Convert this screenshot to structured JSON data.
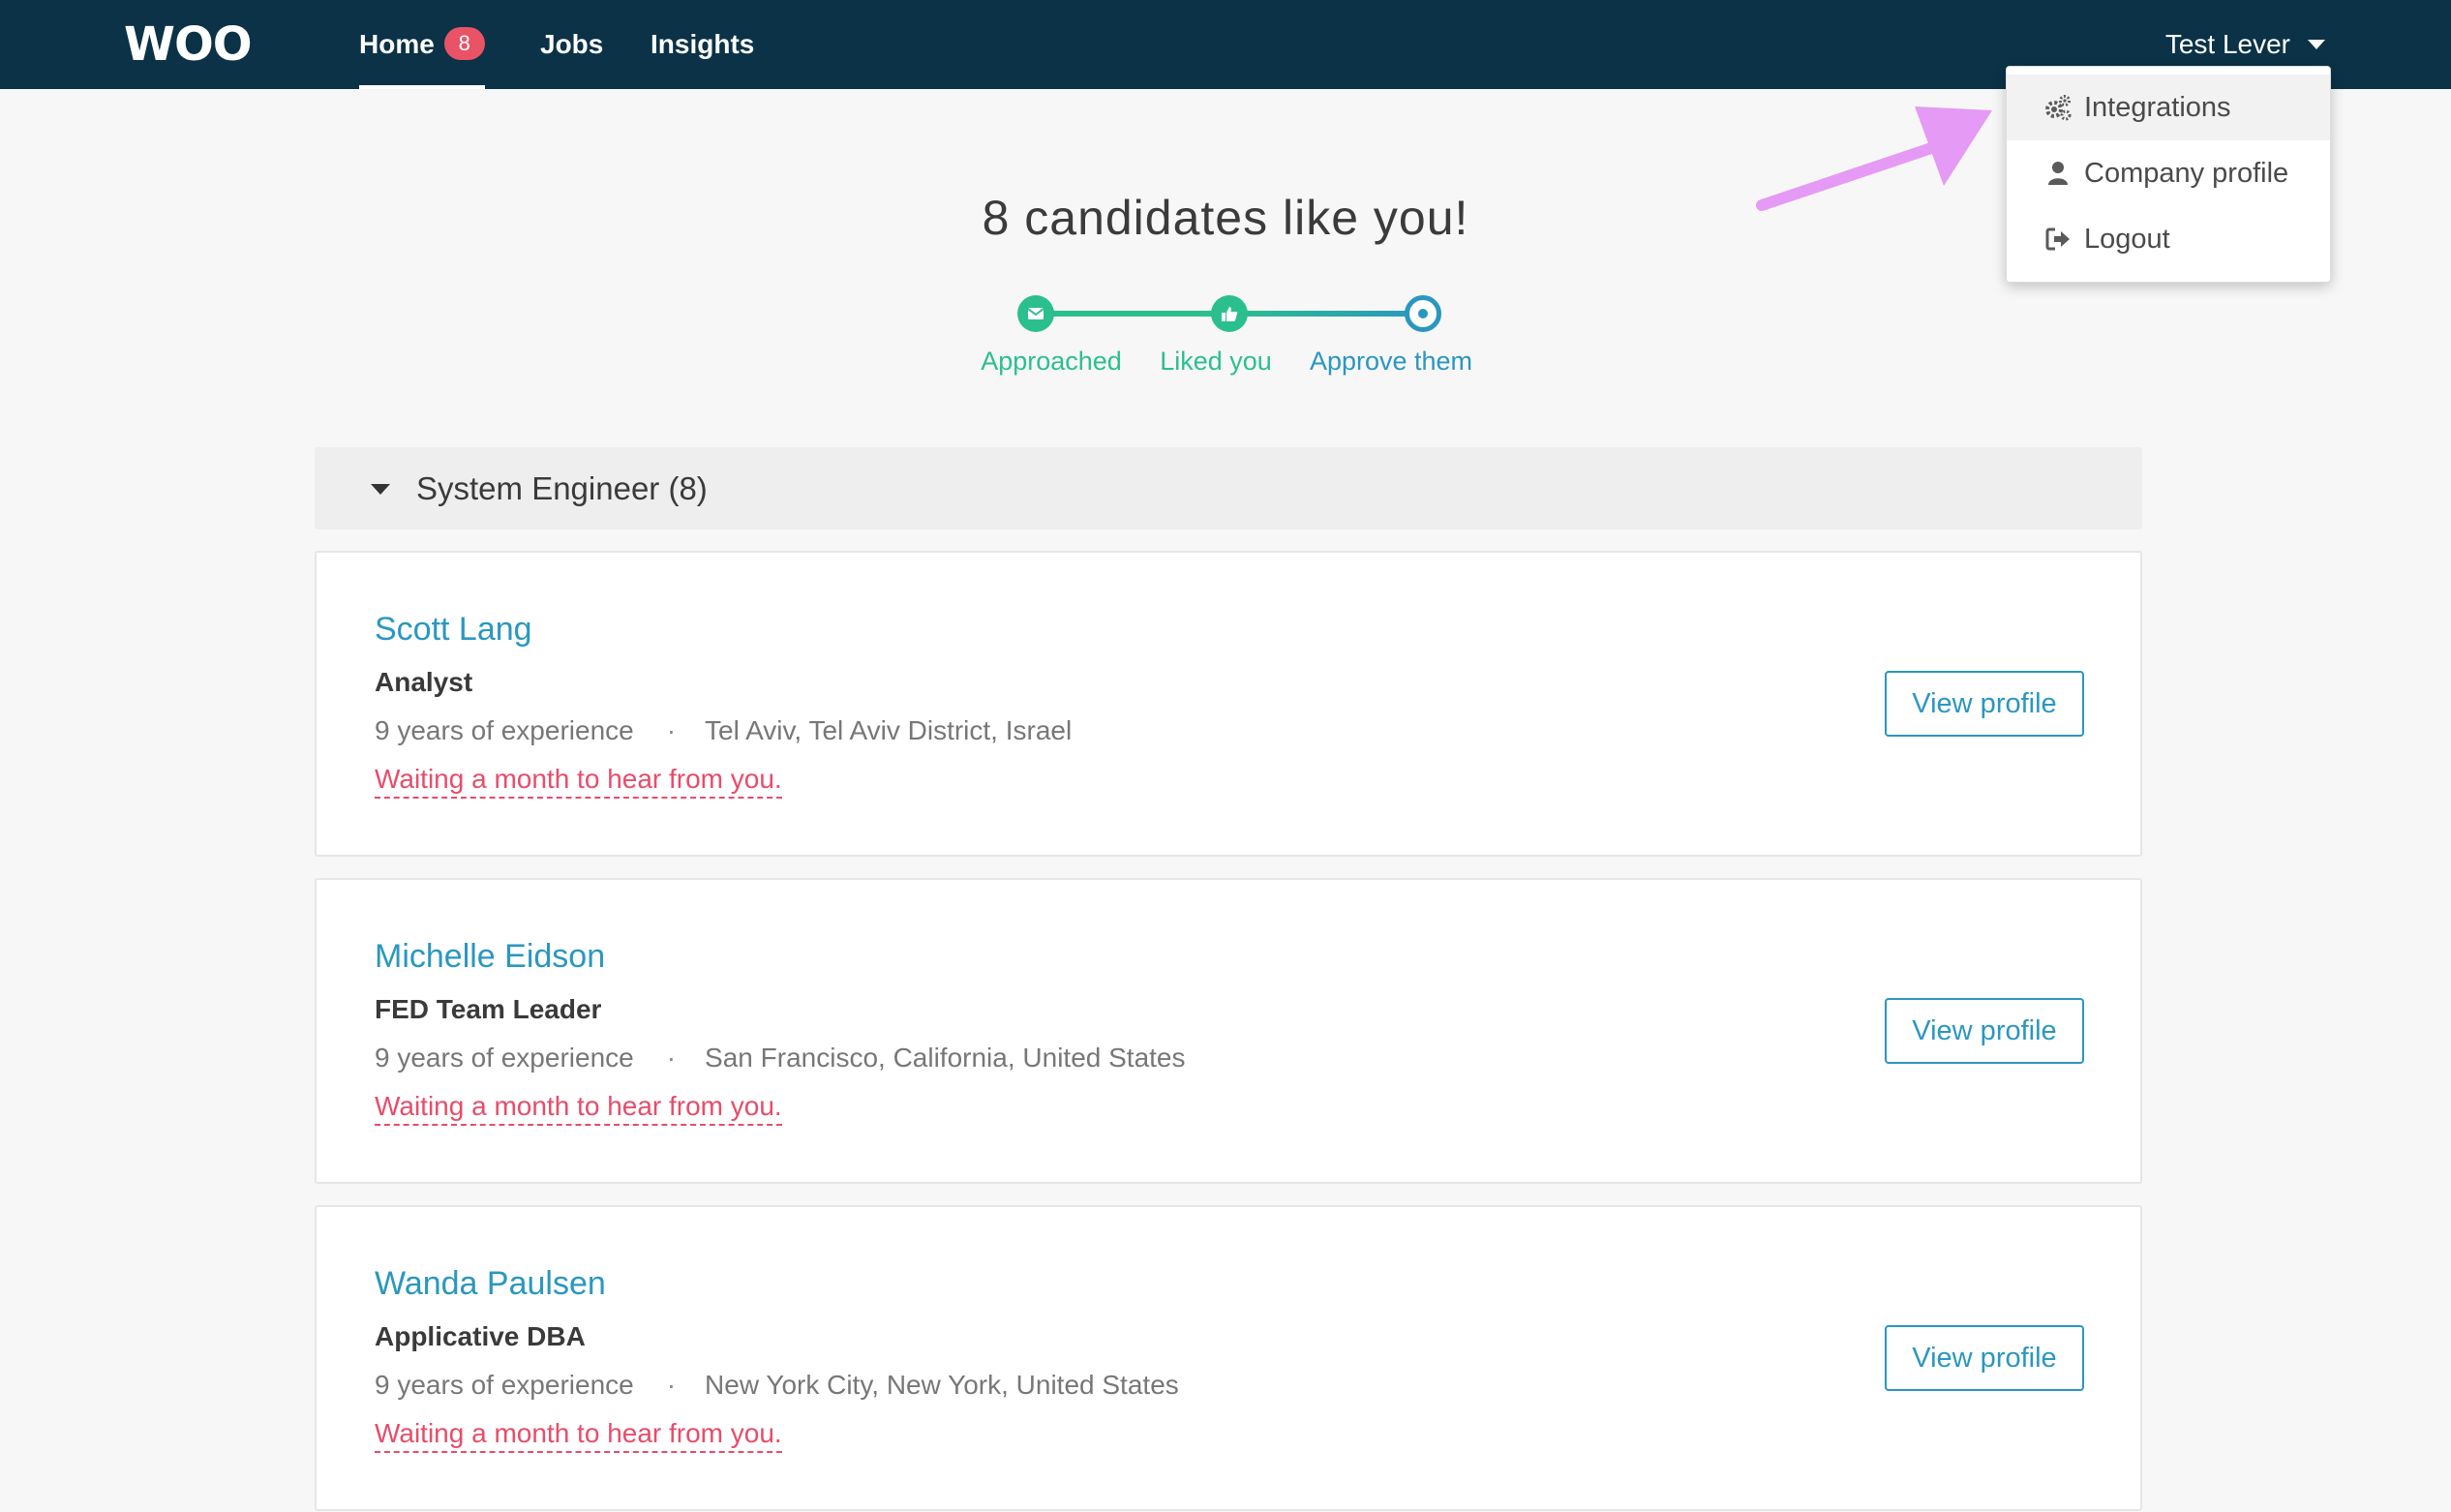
{
  "nav": {
    "logo": "WOO",
    "home_label": "Home",
    "home_badge": "8",
    "jobs_label": "Jobs",
    "insights_label": "Insights",
    "user_name": "Test Lever"
  },
  "user_dropdown": {
    "items": [
      {
        "label": "Integrations",
        "icon": "gears-icon"
      },
      {
        "label": "Company profile",
        "icon": "user-icon"
      },
      {
        "label": "Logout",
        "icon": "logout-icon"
      }
    ]
  },
  "hero": {
    "title": "8 candidates like you!"
  },
  "stepper": {
    "steps": [
      {
        "label": "Approached",
        "icon": "envelope-icon",
        "color": "#2bbf8e"
      },
      {
        "label": "Liked you",
        "icon": "thumbs-up-icon",
        "color": "#2bbf8e"
      },
      {
        "label": "Approve them",
        "icon": "target-icon",
        "color": "#2a97c0"
      }
    ]
  },
  "group": {
    "title": "System Engineer (8)"
  },
  "candidates": [
    {
      "name": "Scott Lang",
      "role": "Analyst",
      "experience": "9 years of experience",
      "location": "Tel Aviv, Tel Aviv District, Israel",
      "status": "Waiting a month to hear from you.",
      "button": "View profile"
    },
    {
      "name": "Michelle Eidson",
      "role": "FED Team Leader",
      "experience": "9 years of experience",
      "location": "San Francisco, California, United States",
      "status": "Waiting a month to hear from you.",
      "button": "View profile"
    },
    {
      "name": "Wanda Paulsen",
      "role": "Applicative DBA",
      "experience": "9 years of experience",
      "location": "New York City, New York, United States",
      "status": "Waiting a month to hear from you.",
      "button": "View profile"
    }
  ],
  "colors": {
    "topbar": "#0b3246",
    "accent": "#2a97c0",
    "success": "#2bbf8e",
    "warning_text": "#e84c6a",
    "badge": "#ea5366",
    "annotation_arrow": "#e59af5"
  }
}
